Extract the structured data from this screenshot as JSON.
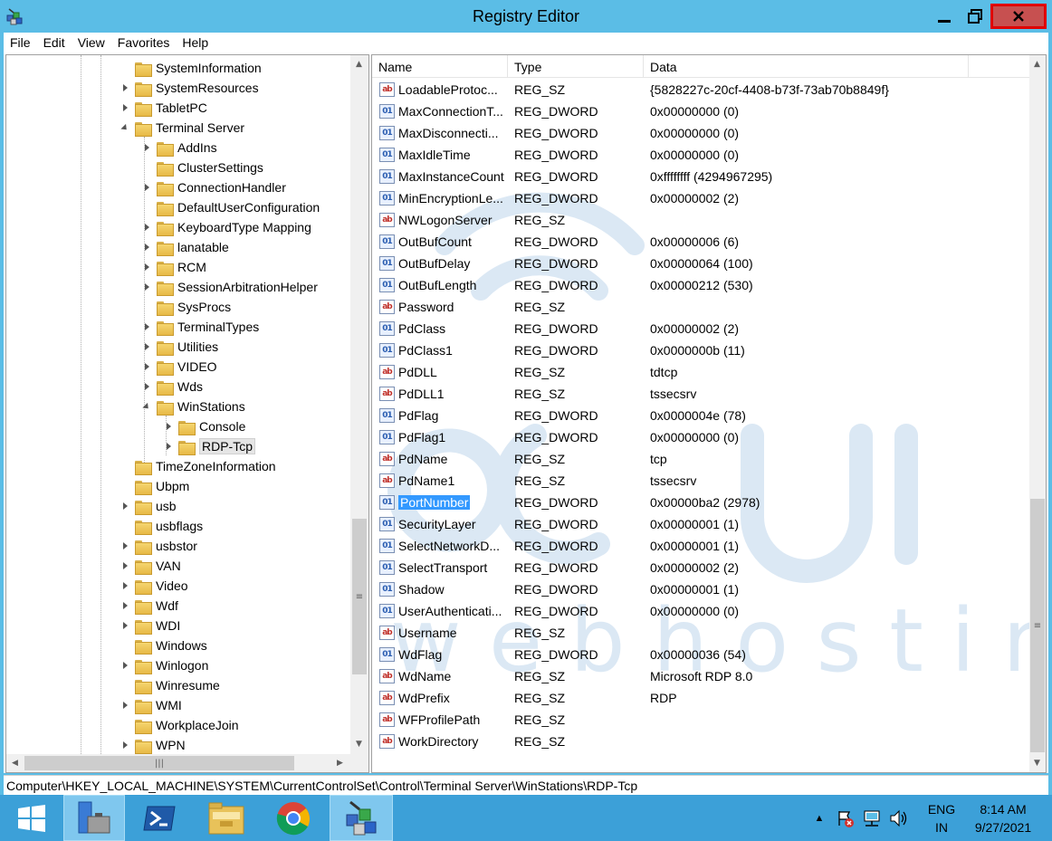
{
  "window": {
    "title": "Registry Editor"
  },
  "menu": [
    "File",
    "Edit",
    "View",
    "Favorites",
    "Help"
  ],
  "tree": [
    {
      "label": "SystemInformation",
      "level": 0,
      "exp": "none"
    },
    {
      "label": "SystemResources",
      "level": 0,
      "exp": "collapsed"
    },
    {
      "label": "TabletPC",
      "level": 0,
      "exp": "collapsed"
    },
    {
      "label": "Terminal Server",
      "level": 0,
      "exp": "expanded"
    },
    {
      "label": "AddIns",
      "level": 1,
      "exp": "collapsed"
    },
    {
      "label": "ClusterSettings",
      "level": 1,
      "exp": "none"
    },
    {
      "label": "ConnectionHandler",
      "level": 1,
      "exp": "collapsed"
    },
    {
      "label": "DefaultUserConfiguration",
      "level": 1,
      "exp": "none"
    },
    {
      "label": "KeyboardType Mapping",
      "level": 1,
      "exp": "collapsed"
    },
    {
      "label": "lanatable",
      "level": 1,
      "exp": "collapsed"
    },
    {
      "label": "RCM",
      "level": 1,
      "exp": "collapsed"
    },
    {
      "label": "SessionArbitrationHelper",
      "level": 1,
      "exp": "collapsed"
    },
    {
      "label": "SysProcs",
      "level": 1,
      "exp": "none"
    },
    {
      "label": "TerminalTypes",
      "level": 1,
      "exp": "collapsed"
    },
    {
      "label": "Utilities",
      "level": 1,
      "exp": "collapsed"
    },
    {
      "label": "VIDEO",
      "level": 1,
      "exp": "collapsed"
    },
    {
      "label": "Wds",
      "level": 1,
      "exp": "collapsed"
    },
    {
      "label": "WinStations",
      "level": 1,
      "exp": "expanded"
    },
    {
      "label": "Console",
      "level": 2,
      "exp": "collapsed"
    },
    {
      "label": "RDP-Tcp",
      "level": 2,
      "exp": "collapsed",
      "selected": true
    },
    {
      "label": "TimeZoneInformation",
      "level": 0,
      "exp": "none"
    },
    {
      "label": "Ubpm",
      "level": 0,
      "exp": "none"
    },
    {
      "label": "usb",
      "level": 0,
      "exp": "collapsed"
    },
    {
      "label": "usbflags",
      "level": 0,
      "exp": "none"
    },
    {
      "label": "usbstor",
      "level": 0,
      "exp": "collapsed"
    },
    {
      "label": "VAN",
      "level": 0,
      "exp": "collapsed"
    },
    {
      "label": "Video",
      "level": 0,
      "exp": "collapsed"
    },
    {
      "label": "Wdf",
      "level": 0,
      "exp": "collapsed"
    },
    {
      "label": "WDI",
      "level": 0,
      "exp": "collapsed"
    },
    {
      "label": "Windows",
      "level": 0,
      "exp": "none"
    },
    {
      "label": "Winlogon",
      "level": 0,
      "exp": "collapsed"
    },
    {
      "label": "Winresume",
      "level": 0,
      "exp": "none"
    },
    {
      "label": "WMI",
      "level": 0,
      "exp": "collapsed"
    },
    {
      "label": "WorkplaceJoin",
      "level": 0,
      "exp": "none"
    },
    {
      "label": "WPN",
      "level": 0,
      "exp": "collapsed"
    }
  ],
  "list": {
    "columns": [
      "Name",
      "Type",
      "Data"
    ],
    "rows": [
      {
        "name": "LoadableProtoc...",
        "type": "REG_SZ",
        "data": "{5828227c-20cf-4408-b73f-73ab70b8849f}"
      },
      {
        "name": "MaxConnectionT...",
        "type": "REG_DWORD",
        "data": "0x00000000 (0)"
      },
      {
        "name": "MaxDisconnecti...",
        "type": "REG_DWORD",
        "data": "0x00000000 (0)"
      },
      {
        "name": "MaxIdleTime",
        "type": "REG_DWORD",
        "data": "0x00000000 (0)"
      },
      {
        "name": "MaxInstanceCount",
        "type": "REG_DWORD",
        "data": "0xffffffff (4294967295)"
      },
      {
        "name": "MinEncryptionLe...",
        "type": "REG_DWORD",
        "data": "0x00000002 (2)"
      },
      {
        "name": "NWLogonServer",
        "type": "REG_SZ",
        "data": ""
      },
      {
        "name": "OutBufCount",
        "type": "REG_DWORD",
        "data": "0x00000006 (6)"
      },
      {
        "name": "OutBufDelay",
        "type": "REG_DWORD",
        "data": "0x00000064 (100)"
      },
      {
        "name": "OutBufLength",
        "type": "REG_DWORD",
        "data": "0x00000212 (530)"
      },
      {
        "name": "Password",
        "type": "REG_SZ",
        "data": ""
      },
      {
        "name": "PdClass",
        "type": "REG_DWORD",
        "data": "0x00000002 (2)"
      },
      {
        "name": "PdClass1",
        "type": "REG_DWORD",
        "data": "0x0000000b (11)"
      },
      {
        "name": "PdDLL",
        "type": "REG_SZ",
        "data": "tdtcp"
      },
      {
        "name": "PdDLL1",
        "type": "REG_SZ",
        "data": "tssecsrv"
      },
      {
        "name": "PdFlag",
        "type": "REG_DWORD",
        "data": "0x0000004e (78)"
      },
      {
        "name": "PdFlag1",
        "type": "REG_DWORD",
        "data": "0x00000000 (0)"
      },
      {
        "name": "PdName",
        "type": "REG_SZ",
        "data": "tcp"
      },
      {
        "name": "PdName1",
        "type": "REG_SZ",
        "data": "tssecsrv"
      },
      {
        "name": "PortNumber",
        "type": "REG_DWORD",
        "data": "0x00000ba2 (2978)",
        "selected": true
      },
      {
        "name": "SecurityLayer",
        "type": "REG_DWORD",
        "data": "0x00000001 (1)"
      },
      {
        "name": "SelectNetworkD...",
        "type": "REG_DWORD",
        "data": "0x00000001 (1)"
      },
      {
        "name": "SelectTransport",
        "type": "REG_DWORD",
        "data": "0x00000002 (2)"
      },
      {
        "name": "Shadow",
        "type": "REG_DWORD",
        "data": "0x00000001 (1)"
      },
      {
        "name": "UserAuthenticati...",
        "type": "REG_DWORD",
        "data": "0x00000000 (0)"
      },
      {
        "name": "Username",
        "type": "REG_SZ",
        "data": ""
      },
      {
        "name": "WdFlag",
        "type": "REG_DWORD",
        "data": "0x00000036 (54)"
      },
      {
        "name": "WdName",
        "type": "REG_SZ",
        "data": "Microsoft RDP 8.0"
      },
      {
        "name": "WdPrefix",
        "type": "REG_SZ",
        "data": "RDP"
      },
      {
        "name": "WFProfilePath",
        "type": "REG_SZ",
        "data": ""
      },
      {
        "name": "WorkDirectory",
        "type": "REG_SZ",
        "data": ""
      }
    ]
  },
  "status": {
    "path": "Computer\\HKEY_LOCAL_MACHINE\\SYSTEM\\CurrentControlSet\\Control\\Terminal Server\\WinStations\\RDP-Tcp"
  },
  "taskbar": {
    "lang_top": "ENG",
    "lang_bottom": "IN",
    "time": "8:14 AM",
    "date": "9/27/2021"
  },
  "colors": {
    "titlebar": "#5bbde6",
    "close_button": "#c75050",
    "highlight": "#e00000",
    "selection": "#3399ff",
    "taskbar": "#3ca0d8"
  },
  "icons": [
    "regedit-icon",
    "minimize-icon",
    "maximize-icon",
    "close-icon",
    "folder-icon",
    "reg-sz-icon",
    "reg-dword-icon",
    "start-icon",
    "server-manager-icon",
    "powershell-icon",
    "file-explorer-icon",
    "chrome-icon",
    "regedit-taskbar-icon",
    "show-hidden-icons-icon",
    "action-center-icon",
    "network-icon",
    "volume-icon"
  ]
}
